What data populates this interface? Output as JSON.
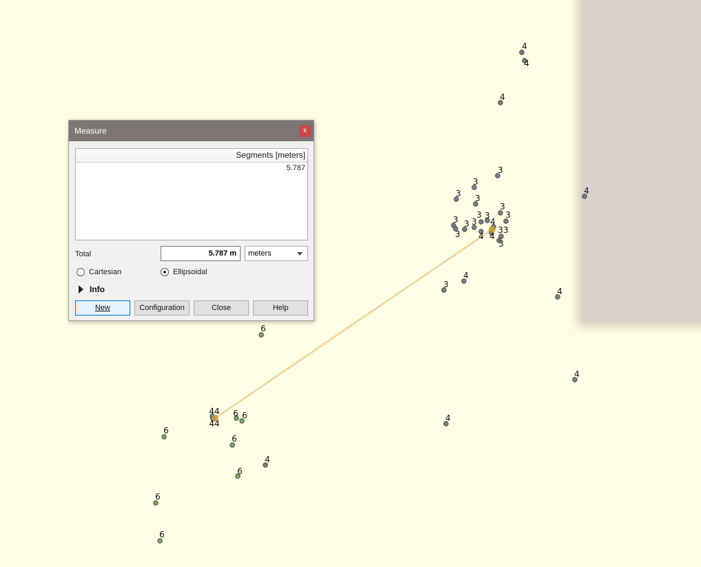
{
  "colors": {
    "map_bg": "#fefee6",
    "grey_point": "#7a8086",
    "green_point": "#7fa36a",
    "measure_line": "#efd9a8",
    "endpoint": "#c8963a"
  },
  "map": {
    "grey_labels": [
      "4",
      "4",
      "4",
      "3",
      "3",
      "3",
      "3",
      "3",
      "3",
      "3",
      "3",
      "3",
      "3",
      "3",
      "3",
      "4",
      "33",
      "3",
      "4",
      "4",
      "4",
      "3",
      "4",
      "4",
      "4",
      "4",
      "4",
      "44",
      "44"
    ],
    "green_labels": [
      "6",
      "6",
      "6",
      "6",
      "6",
      "6",
      "6",
      "6"
    ]
  },
  "dialog": {
    "title": "Measure",
    "close_glyph": "x",
    "table_header": "Segments [meters]",
    "segments": [
      "5.787"
    ],
    "total_label": "Total",
    "total_value": "5.787 m",
    "unit_selected": "meters",
    "radio_cartesian": "Cartesian",
    "radio_ellipsoidal": "Ellipsoidal",
    "selected_mode": "Ellipsoidal",
    "info_label": "Info",
    "buttons": {
      "new": "New",
      "configuration": "Configuration",
      "close": "Close",
      "help": "Help"
    }
  }
}
